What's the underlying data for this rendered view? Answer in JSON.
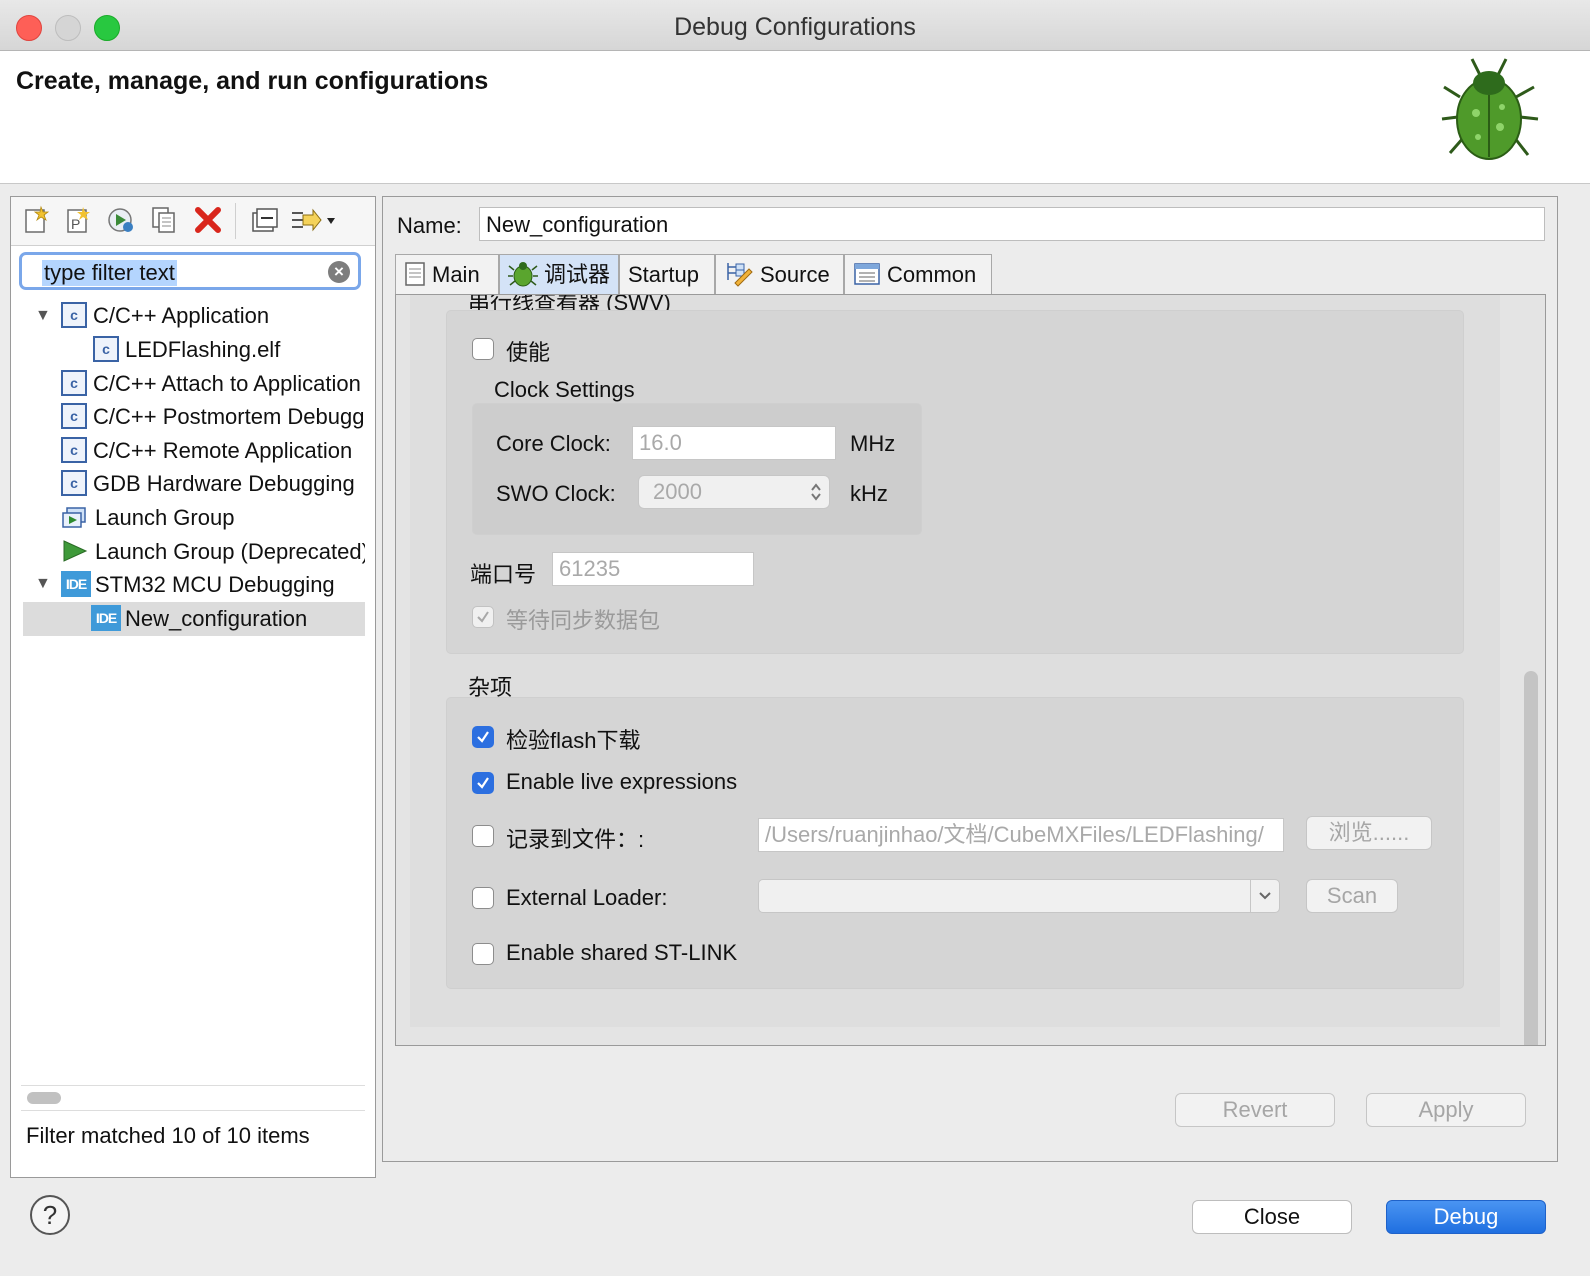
{
  "window": {
    "title": "Debug Configurations",
    "controls": {
      "close_color": "#fe5f57",
      "minimize_color": "#d5d5d5",
      "zoom_color": "#28c840"
    }
  },
  "header": {
    "title": "Create, manage, and run configurations",
    "icon": "bug-icon"
  },
  "left": {
    "toolbar": [
      "new-launch-configuration-icon",
      "new-prototype-icon",
      "export-icon",
      "duplicate-icon",
      "delete-icon",
      "collapse-all-icon",
      "filter-icon"
    ],
    "filter": {
      "placeholder": "type filter text",
      "value": "type filter text"
    },
    "tree": [
      {
        "label": "C/C++ Application",
        "icon": "c-icon",
        "expanded": true
      },
      {
        "label": "LEDFlashing.elf",
        "icon": "c-icon"
      },
      {
        "label": "C/C++ Attach to Application",
        "icon": "c-icon"
      },
      {
        "label": "C/C++ Postmortem Debugger",
        "icon": "c-icon"
      },
      {
        "label": "C/C++ Remote Application",
        "icon": "c-icon"
      },
      {
        "label": "GDB Hardware Debugging",
        "icon": "c-icon"
      },
      {
        "label": "Launch Group",
        "icon": "launch-group-icon"
      },
      {
        "label": "Launch Group (Deprecated)",
        "icon": "launch-group-deprecated-icon"
      },
      {
        "label": "STM32 MCU Debugging",
        "icon": "ide-icon",
        "expanded": true
      },
      {
        "label": "New_configuration",
        "icon": "ide-icon",
        "selected": true
      }
    ],
    "ide_icon_text": "IDE",
    "c_icon_text": "c",
    "status": "Filter matched 10 of 10 items"
  },
  "right": {
    "name_label": "Name:",
    "name_value": "New_configuration",
    "tabs": [
      {
        "label": "Main",
        "icon": "main-tab-icon"
      },
      {
        "label": "调试器",
        "icon": "debugger-tab-icon",
        "active": true
      },
      {
        "label": "Startup"
      },
      {
        "label": "Source",
        "icon": "source-tab-icon"
      },
      {
        "label": "Common",
        "icon": "common-tab-icon"
      }
    ],
    "swv": {
      "section_title": "串行线查看器 (SWV)",
      "enable_label": "使能",
      "enable_checked": false,
      "clock_settings_title": "Clock Settings",
      "core_clock_label": "Core Clock:",
      "core_clock_value": "16.0",
      "core_clock_unit": "MHz",
      "swo_clock_label": "SWO Clock:",
      "swo_clock_value": "2000",
      "swo_clock_unit": "kHz",
      "port_label": "端口号",
      "port_value": "61235",
      "wait_sync_label": "等待同步数据包",
      "wait_sync_checked": true
    },
    "misc": {
      "section_title": "杂项",
      "verify_flash_label": "检验flash下载",
      "verify_flash_checked": true,
      "live_expr_label": "Enable live expressions",
      "live_expr_checked": true,
      "log_file_label": "记录到文件：:",
      "log_file_checked": false,
      "log_file_value": "/Users/ruanjinhao/文档/CubeMXFiles/LEDFlashing/",
      "browse_label": "浏览......",
      "ext_loader_label": "External Loader:",
      "ext_loader_checked": false,
      "ext_loader_value": "",
      "scan_label": "Scan",
      "shared_stlink_label": "Enable shared ST-LINK",
      "shared_stlink_checked": false
    },
    "revert_label": "Revert",
    "apply_label": "Apply"
  },
  "bottom": {
    "help_label": "?",
    "close_label": "Close",
    "debug_label": "Debug",
    "accent": "#2b7de9"
  }
}
